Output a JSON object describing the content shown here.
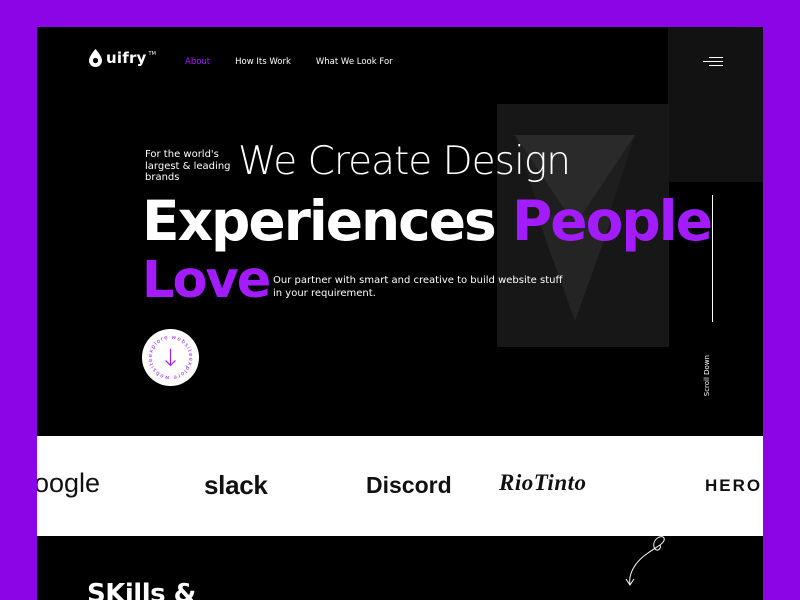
{
  "brand": {
    "name": "uifry",
    "trademark": "TM"
  },
  "nav": {
    "items": [
      {
        "label": "About",
        "active": true
      },
      {
        "label": "How Its Work",
        "active": false
      },
      {
        "label": "What We Look For",
        "active": false
      }
    ]
  },
  "hero": {
    "tagline": "For the world's largest & leading brands",
    "headline_line1": "We Create Design",
    "headline_line2_a": "Experiences",
    "headline_line2_b": "People",
    "headline_line3": "Love",
    "subtext": "Our partner with smart and creative  to build website stuff in your requirement.",
    "explore_label": "explore website",
    "scroll_label": "Scroll Down"
  },
  "brands": {
    "logos": [
      "oogle",
      "slack",
      "Discord",
      "RioTinto",
      "HEROK"
    ]
  },
  "skills": {
    "title": "SKills &"
  },
  "colors": {
    "accent": "#A21CFF",
    "frame_border": "#8B05E6",
    "background": "#000000",
    "brand_strip": "#FFFFFF"
  }
}
